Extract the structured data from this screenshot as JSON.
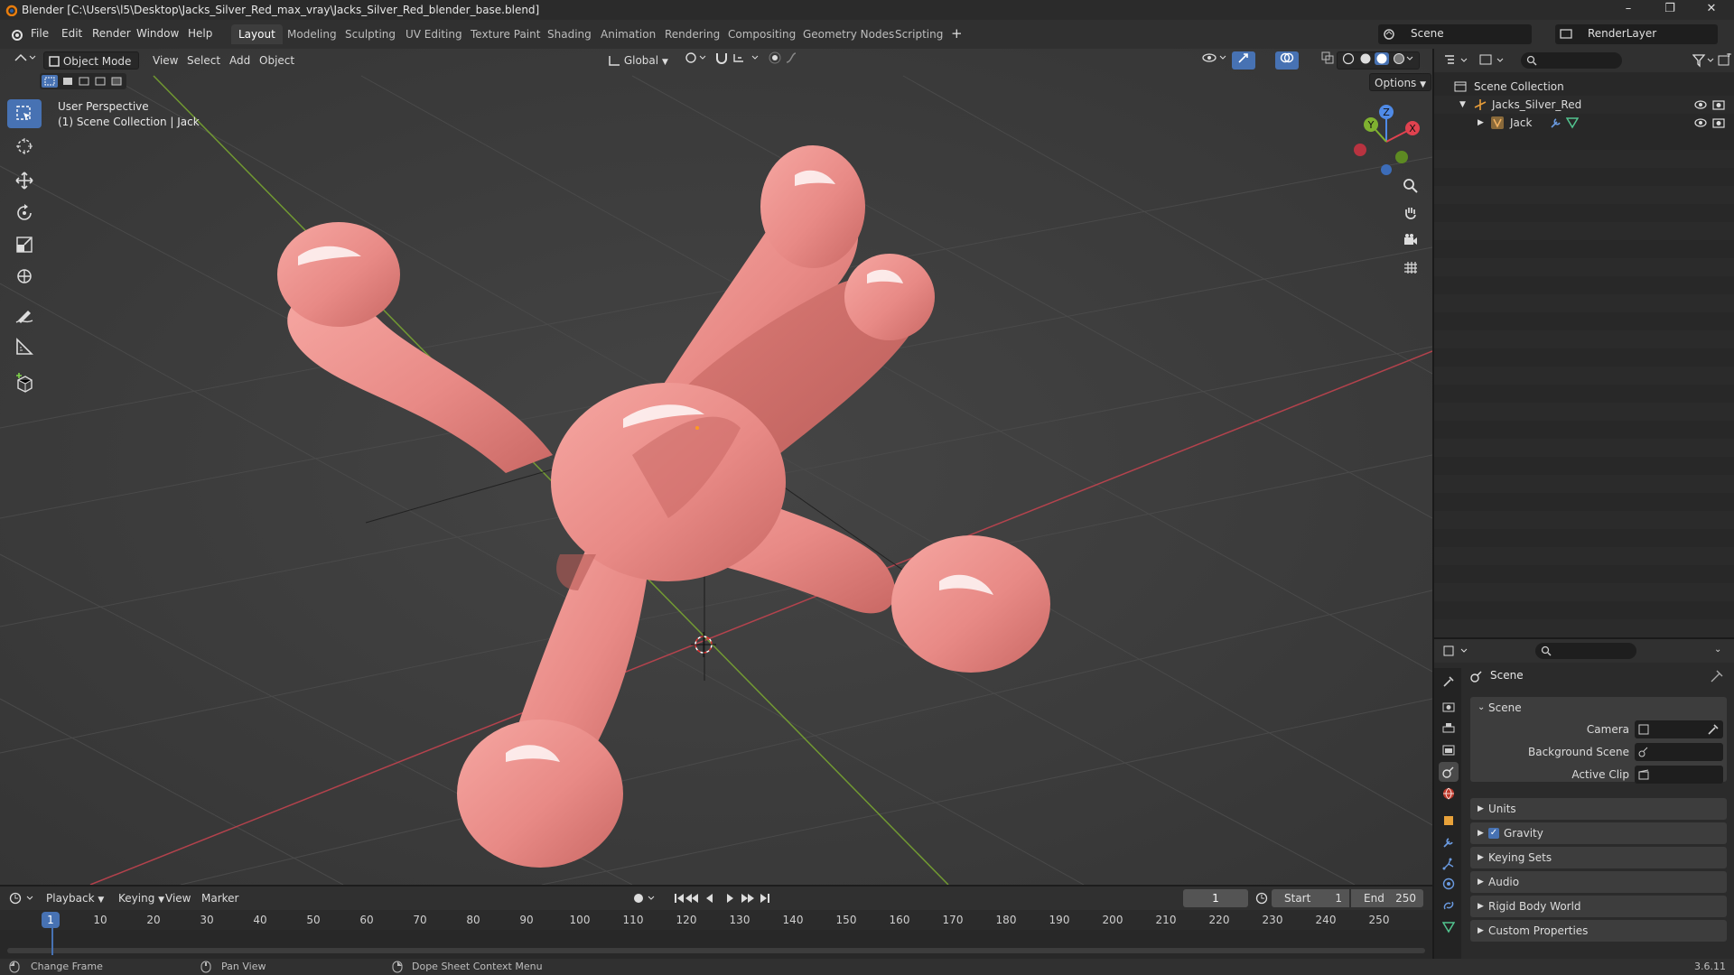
{
  "title_bar": {
    "title": "Blender [C:\\Users\\l5\\Desktop\\Jacks_Silver_Red_max_vray\\Jacks_Silver_Red_blender_base.blend]",
    "minimize": "–",
    "maximize": "❐",
    "close": "✕"
  },
  "menu": {
    "items": [
      "File",
      "Edit",
      "Render",
      "Window",
      "Help"
    ]
  },
  "workspaces": {
    "tabs": [
      "Layout",
      "Modeling",
      "Sculpting",
      "UV Editing",
      "Texture Paint",
      "Shading",
      "Animation",
      "Rendering",
      "Compositing",
      "Geometry Nodes",
      "Scripting"
    ],
    "active": "Layout",
    "add": "+"
  },
  "top_right": {
    "scene": "Scene",
    "view_layer": "RenderLayer"
  },
  "viewport_header": {
    "mode": "Object Mode",
    "menus": [
      "View",
      "Select",
      "Add",
      "Object"
    ],
    "orientation": "Global",
    "options": "Options"
  },
  "viewport_overlay": {
    "perspective": "User Perspective",
    "collection": "(1) Scene Collection | Jack"
  },
  "gizmo": {
    "x": "X",
    "y": "Y",
    "z": "Z"
  },
  "outliner": {
    "root": "Scene Collection",
    "collection": "Jacks_Silver_Red",
    "object": "Jack"
  },
  "properties": {
    "header": "Scene",
    "section": "Scene",
    "fields": {
      "camera": "Camera",
      "background_scene": "Background Scene",
      "active_clip": "Active Clip"
    },
    "panels": [
      "Units",
      "Gravity",
      "Keying Sets",
      "Audio",
      "Rigid Body World",
      "Custom Properties"
    ],
    "gravity_enabled": true
  },
  "timeline": {
    "menus": [
      "Playback",
      "Keying",
      "View",
      "Marker"
    ],
    "current_frame": "1",
    "start_label": "Start",
    "start": "1",
    "end_label": "End",
    "end": "250",
    "ticks": [
      "1",
      "10",
      "20",
      "30",
      "40",
      "50",
      "60",
      "70",
      "80",
      "90",
      "100",
      "110",
      "120",
      "130",
      "140",
      "150",
      "160",
      "170",
      "180",
      "190",
      "200",
      "210",
      "220",
      "230",
      "240",
      "250"
    ]
  },
  "statusbar": {
    "hints": [
      "Change Frame",
      "Pan View",
      "Dope Sheet Context Menu"
    ],
    "version": "3.6.11"
  },
  "colors": {
    "accent": "#4772b3",
    "object_color": "#e88a86",
    "x_axis": "#e0424f",
    "y_axis": "#7fb130",
    "z_axis": "#4f8be8"
  }
}
